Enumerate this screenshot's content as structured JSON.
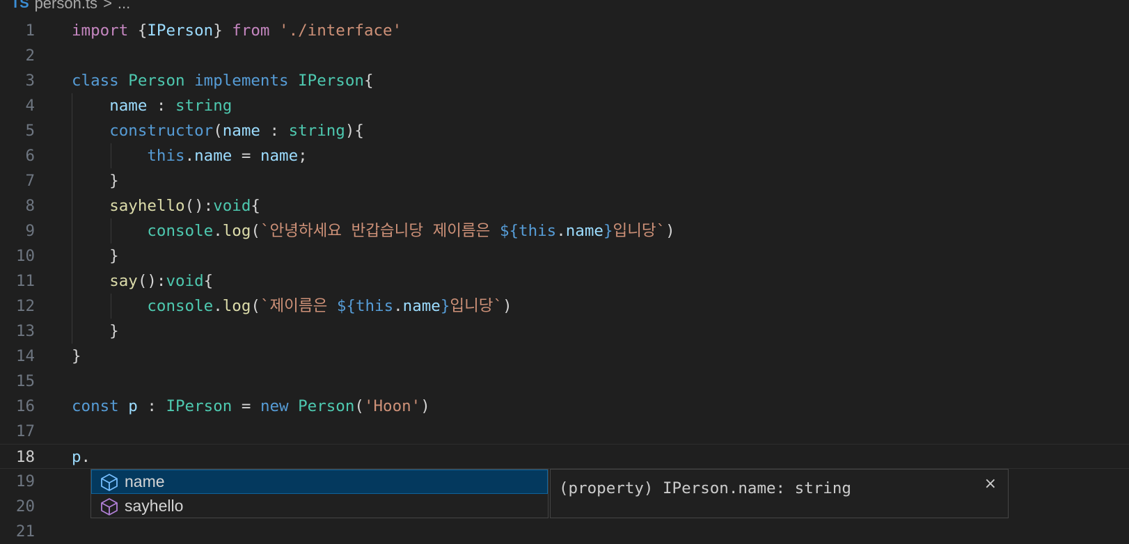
{
  "breadcrumb": {
    "icon_text": "TS",
    "file": "person.ts",
    "separator": ">",
    "rest": "..."
  },
  "lines": [
    {
      "n": "1",
      "tokens": [
        [
          "kw2",
          "import"
        ],
        [
          "pu",
          " {"
        ],
        [
          "va",
          "IPerson"
        ],
        [
          "pu",
          "} "
        ],
        [
          "kw2",
          "from"
        ],
        [
          "pu",
          " "
        ],
        [
          "st",
          "'./interface'"
        ]
      ]
    },
    {
      "n": "2",
      "tokens": []
    },
    {
      "n": "3",
      "tokens": [
        [
          "kw",
          "class"
        ],
        [
          "pu",
          " "
        ],
        [
          "ty",
          "Person"
        ],
        [
          "pu",
          " "
        ],
        [
          "kw",
          "implements"
        ],
        [
          "pu",
          " "
        ],
        [
          "ty",
          "IPerson"
        ],
        [
          "pu",
          "{"
        ]
      ]
    },
    {
      "n": "4",
      "tokens": [
        [
          "pu",
          "    "
        ],
        [
          "va",
          "name"
        ],
        [
          "pu",
          " : "
        ],
        [
          "ty",
          "string"
        ]
      ]
    },
    {
      "n": "5",
      "tokens": [
        [
          "pu",
          "    "
        ],
        [
          "kw",
          "constructor"
        ],
        [
          "pu",
          "("
        ],
        [
          "va",
          "name"
        ],
        [
          "pu",
          " : "
        ],
        [
          "ty",
          "string"
        ],
        [
          "pu",
          "){"
        ]
      ]
    },
    {
      "n": "6",
      "tokens": [
        [
          "pu",
          "        "
        ],
        [
          "kw",
          "this"
        ],
        [
          "pu",
          "."
        ],
        [
          "va",
          "name"
        ],
        [
          "pu",
          " = "
        ],
        [
          "va",
          "name"
        ],
        [
          "pu",
          ";"
        ]
      ]
    },
    {
      "n": "7",
      "tokens": [
        [
          "pu",
          "    }"
        ]
      ]
    },
    {
      "n": "8",
      "tokens": [
        [
          "pu",
          "    "
        ],
        [
          "fn",
          "sayhello"
        ],
        [
          "pu",
          "():"
        ],
        [
          "ty",
          "void"
        ],
        [
          "pu",
          "{"
        ]
      ]
    },
    {
      "n": "9",
      "tokens": [
        [
          "pu",
          "        "
        ],
        [
          "ty",
          "console"
        ],
        [
          "pu",
          "."
        ],
        [
          "fn",
          "log"
        ],
        [
          "pu",
          "("
        ],
        [
          "st",
          "`안녕하세요 반갑습니당 제이름은 "
        ],
        [
          "kw",
          "${"
        ],
        [
          "kw",
          "this"
        ],
        [
          "pu",
          "."
        ],
        [
          "va",
          "name"
        ],
        [
          "kw",
          "}"
        ],
        [
          "st",
          "입니당`"
        ],
        [
          "pu",
          ")"
        ]
      ]
    },
    {
      "n": "10",
      "tokens": [
        [
          "pu",
          "    }"
        ]
      ]
    },
    {
      "n": "11",
      "tokens": [
        [
          "pu",
          "    "
        ],
        [
          "fn",
          "say"
        ],
        [
          "pu",
          "():"
        ],
        [
          "ty",
          "void"
        ],
        [
          "pu",
          "{"
        ]
      ]
    },
    {
      "n": "12",
      "tokens": [
        [
          "pu",
          "        "
        ],
        [
          "ty",
          "console"
        ],
        [
          "pu",
          "."
        ],
        [
          "fn",
          "log"
        ],
        [
          "pu",
          "("
        ],
        [
          "st",
          "`제이름은 "
        ],
        [
          "kw",
          "${"
        ],
        [
          "kw",
          "this"
        ],
        [
          "pu",
          "."
        ],
        [
          "va",
          "name"
        ],
        [
          "kw",
          "}"
        ],
        [
          "st",
          "입니당`"
        ],
        [
          "pu",
          ")"
        ]
      ]
    },
    {
      "n": "13",
      "tokens": [
        [
          "pu",
          "    }"
        ]
      ]
    },
    {
      "n": "14",
      "tokens": [
        [
          "pu",
          "}"
        ]
      ]
    },
    {
      "n": "15",
      "tokens": []
    },
    {
      "n": "16",
      "tokens": [
        [
          "kw",
          "const"
        ],
        [
          "pu",
          " "
        ],
        [
          "va",
          "p"
        ],
        [
          "pu",
          " : "
        ],
        [
          "ty",
          "IPerson"
        ],
        [
          "pu",
          " = "
        ],
        [
          "kw",
          "new"
        ],
        [
          "pu",
          " "
        ],
        [
          "ty",
          "Person"
        ],
        [
          "pu",
          "("
        ],
        [
          "st",
          "'Hoon'"
        ],
        [
          "pu",
          ")"
        ]
      ]
    },
    {
      "n": "17",
      "tokens": []
    },
    {
      "n": "18",
      "tokens": [
        [
          "va",
          "p"
        ],
        [
          "pu",
          "."
        ]
      ],
      "current": true
    },
    {
      "n": "19",
      "tokens": []
    },
    {
      "n": "20",
      "tokens": []
    },
    {
      "n": "21",
      "tokens": []
    }
  ],
  "suggest": {
    "items": [
      {
        "label": "name",
        "icon": "property-icon",
        "selected": true
      },
      {
        "label": "sayhello",
        "icon": "method-icon",
        "selected": false
      }
    ],
    "detail": "(property) IPerson.name: string",
    "close_glyph": "×"
  },
  "colors": {
    "accent": "#04395e",
    "keyword": "#569cd6",
    "type": "#4ec9b0",
    "string": "#ce9178"
  }
}
